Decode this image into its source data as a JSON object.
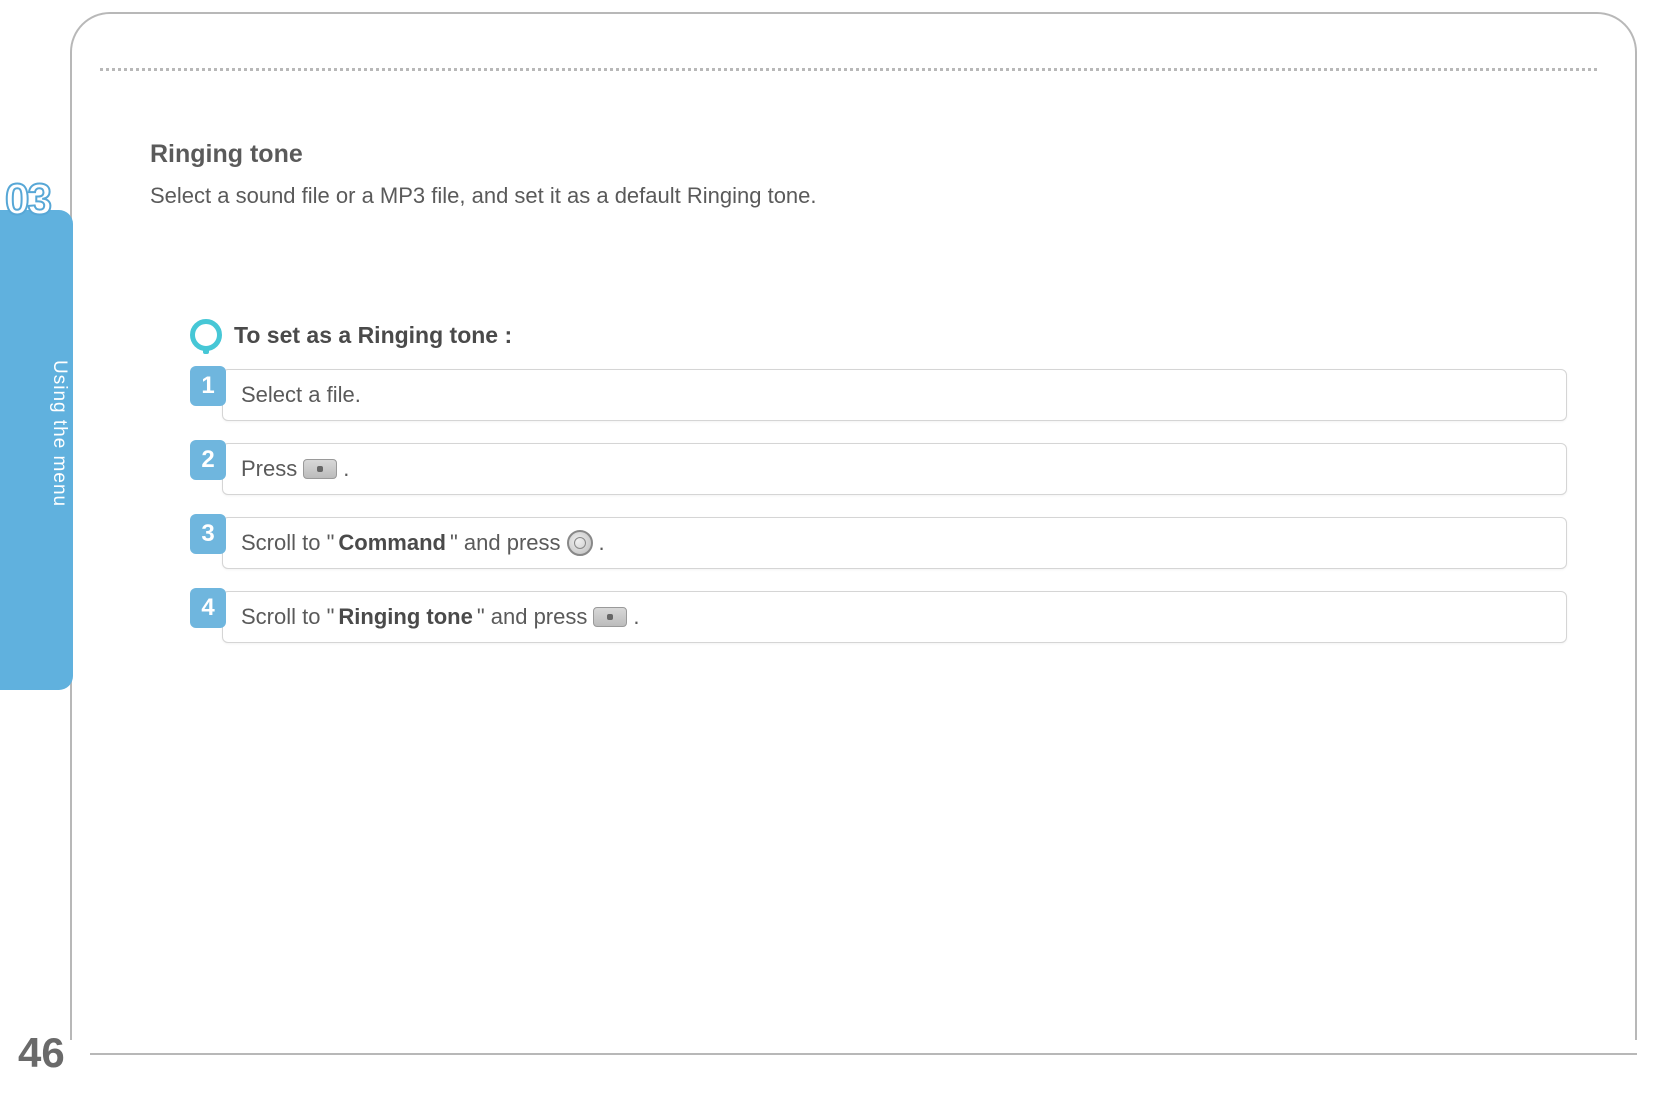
{
  "chapter": {
    "number": "03",
    "tab_label": "Using the menu"
  },
  "page_number": "46",
  "section": {
    "title": "Ringing tone",
    "description": "Select a sound file or a MP3 file, and set it as a default Ringing tone."
  },
  "steps": {
    "heading": "To set as a Ringing tone :",
    "items": [
      {
        "num": "1",
        "parts": [
          {
            "t": "text",
            "v": "Select a file."
          }
        ]
      },
      {
        "num": "2",
        "parts": [
          {
            "t": "text",
            "v": "Press "
          },
          {
            "t": "icon",
            "v": "softkey-dot"
          },
          {
            "t": "text",
            "v": "."
          }
        ]
      },
      {
        "num": "3",
        "parts": [
          {
            "t": "text",
            "v": "Scroll to \""
          },
          {
            "t": "bold",
            "v": "Command"
          },
          {
            "t": "text",
            "v": "\" and press "
          },
          {
            "t": "icon",
            "v": "nav-round"
          },
          {
            "t": "text",
            "v": "."
          }
        ]
      },
      {
        "num": "4",
        "parts": [
          {
            "t": "text",
            "v": "Scroll to \""
          },
          {
            "t": "bold",
            "v": "Ringing tone"
          },
          {
            "t": "text",
            "v": "\" and press "
          },
          {
            "t": "icon",
            "v": "softkey-dot"
          },
          {
            "t": "text",
            "v": "."
          }
        ]
      }
    ]
  }
}
